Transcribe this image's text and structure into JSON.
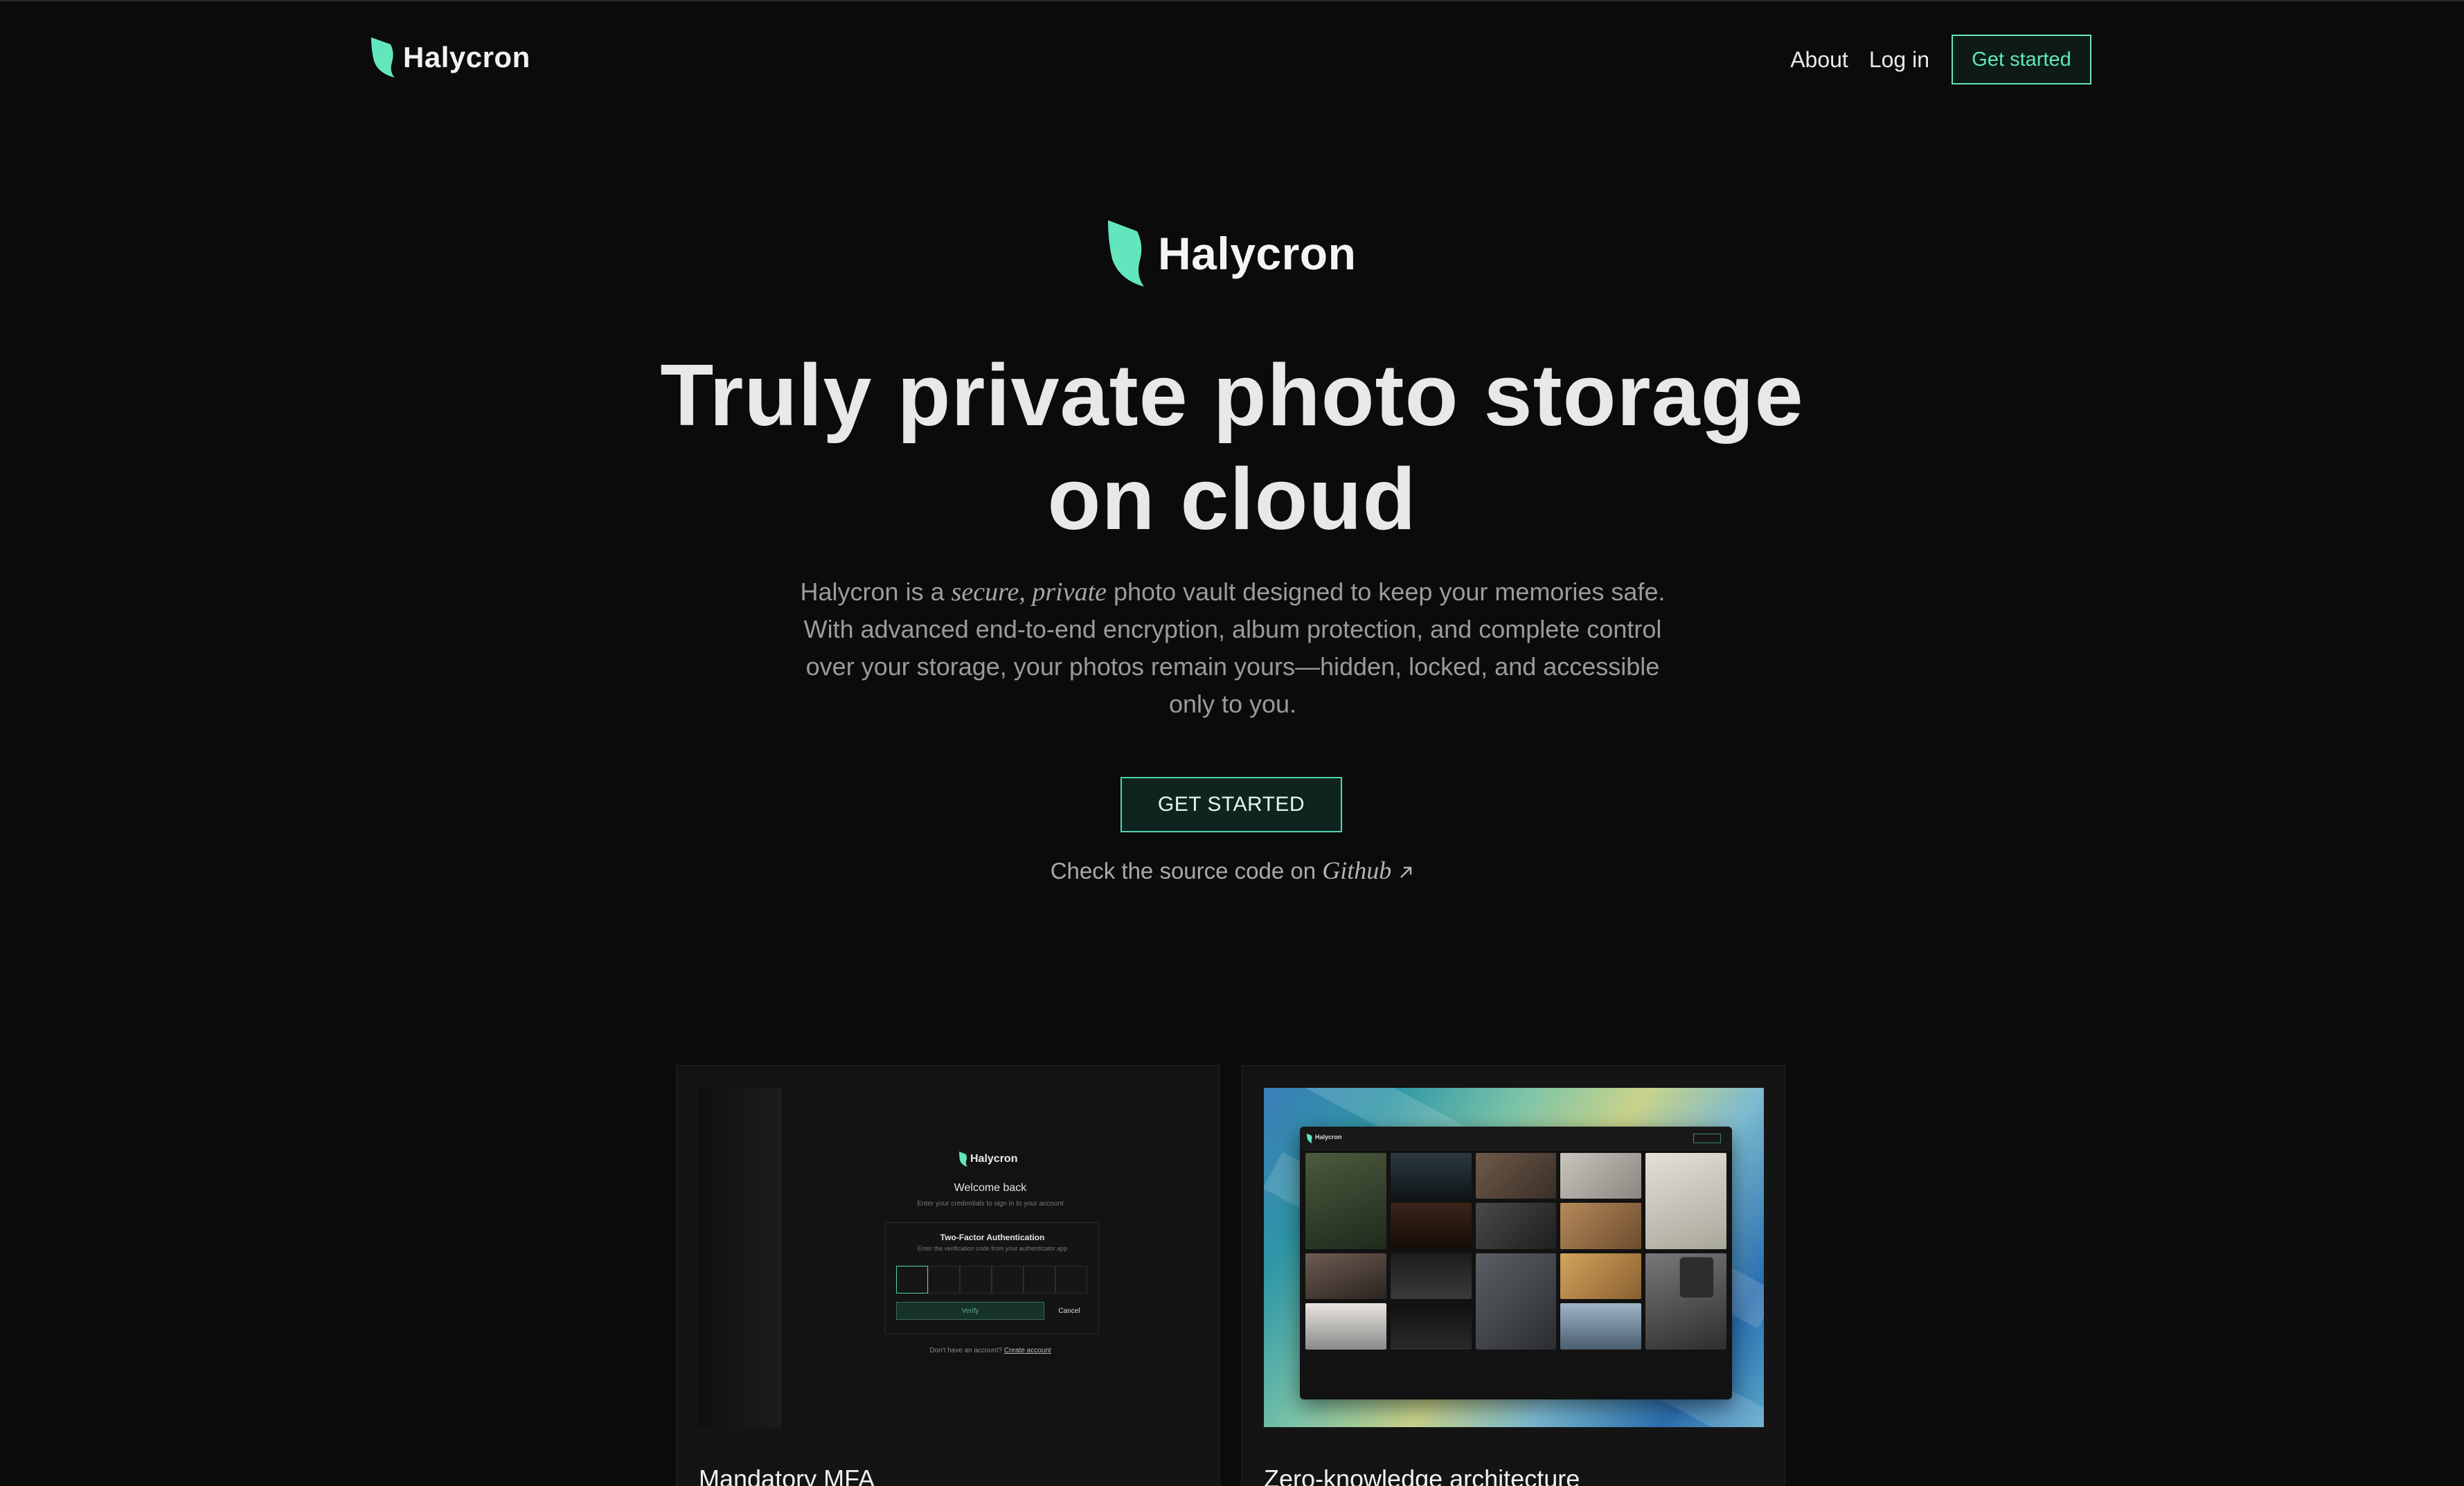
{
  "colors": {
    "accent": "#63e6be",
    "background": "#0b0b0b"
  },
  "nav": {
    "brand": "Halycron",
    "links": [
      "About",
      "Log in"
    ],
    "cta": "Get started"
  },
  "hero": {
    "brand": "Halycron",
    "headline_line1": "Truly private photo storage",
    "headline_line2": "on cloud",
    "sub_prefix": "Halycron is a ",
    "sub_em": "secure, private",
    "sub_rest": " photo vault designed to keep your memories safe. With advanced end-to-end encryption, album protection, and complete control over your storage, your photos remain yours—hidden, locked, and accessible only to you.",
    "cta": "GET STARTED",
    "source_prefix": "Check the source code on ",
    "source_link": "Github",
    "source_icon": "arrow-up-right-icon"
  },
  "features": [
    {
      "title": "Mandatory MFA",
      "preview": {
        "brand": "Halycron",
        "welcome": "Welcome back",
        "welcome_sub": "Enter your credentials to sign in to your account",
        "box_title": "Two-Factor Authentication",
        "box_sub": "Enter the verification code from your authenticator app",
        "verify": "Verify",
        "cancel": "Cancel",
        "foot_prefix": "Don't have an account? ",
        "foot_link": "Create account"
      }
    },
    {
      "title": "Zero-knowledge architecture",
      "preview": {
        "brand": "Halycron"
      }
    }
  ]
}
